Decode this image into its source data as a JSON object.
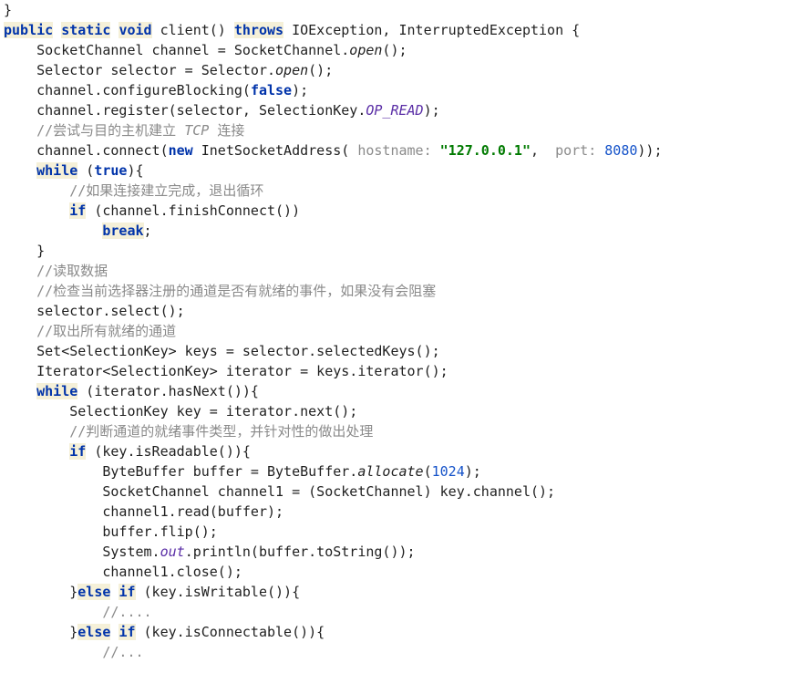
{
  "code": {
    "l01": "}",
    "l02": {
      "kw1": "public",
      "kw2": "static",
      "kw3": "void",
      "name": " client() ",
      "kw4": "throws",
      "exc": " IOException, InterruptedException {"
    },
    "l03a": "    SocketChannel channel = SocketChannel.",
    "l03m": "open",
    "l03b": "();",
    "l04a": "    Selector selector = Selector.",
    "l04m": "open",
    "l04b": "();",
    "l05a": "    channel.configureBlocking(",
    "l05k": "false",
    "l05b": ");",
    "l06a": "    channel.register(selector, SelectionKey.",
    "l06f": "OP_READ",
    "l06b": ");",
    "l07p": "    ",
    "l07c1": "//尝试与目的主机建立 ",
    "l07c2": "TCP",
    "l07c3": " 连接",
    "l08a": "    channel.connect(",
    "l08k": "new",
    "l08b": " InetSocketAddress( ",
    "l08h1": "hostname: ",
    "l08s": "\"127.0.0.1\"",
    "l08c": ",  ",
    "l08h2": "port: ",
    "l08n": "8080",
    "l08d": "));",
    "l09p": "    ",
    "l09k": "while",
    "l09a": " (",
    "l09t": "true",
    "l09b": "){",
    "l10p": "        ",
    "l10c": "//如果连接建立完成，退出循环",
    "l11p": "        ",
    "l11k": "if",
    "l11a": " (channel.finishConnect())",
    "l12p": "            ",
    "l12k": "break",
    "l12a": ";",
    "l13": "    }",
    "l14p": "    ",
    "l14c": "//读取数据",
    "l15p": "    ",
    "l15c": "//检查当前选择器注册的通道是否有就绪的事件，如果没有会阻塞",
    "l16": "    selector.select();",
    "l17p": "    ",
    "l17c": "//取出所有就绪的通道",
    "l18": "    Set<SelectionKey> keys = selector.selectedKeys();",
    "l19": "    Iterator<SelectionKey> iterator = keys.iterator();",
    "l20p": "    ",
    "l20k": "while",
    "l20a": " (iterator.hasNext()){",
    "l21": "        SelectionKey key = iterator.next();",
    "l22p": "        ",
    "l22c": "//判断通道的就绪事件类型，并针对性的做出处理",
    "l23p": "        ",
    "l23k": "if",
    "l23a": " (key.isReadable()){",
    "l24a": "            ByteBuffer buffer = ByteBuffer.",
    "l24m": "allocate",
    "l24b": "(",
    "l24n": "1024",
    "l24c": ");",
    "l25": "            SocketChannel channel1 = (SocketChannel) key.channel();",
    "l26": "            channel1.read(buffer);",
    "l27": "            buffer.flip();",
    "l28a": "            System.",
    "l28f": "out",
    "l28b": ".println(buffer.toString());",
    "l29": "            channel1.close();",
    "l30a": "        }",
    "l30k1": "else",
    "l30s": " ",
    "l30k2": "if",
    "l30b": " (key.isWritable()){",
    "l31p": "            ",
    "l31c": "//....",
    "l32a": "        }",
    "l32k1": "else",
    "l32s": " ",
    "l32k2": "if",
    "l32b": " (key.isConnectable()){",
    "l33p": "            ",
    "l33c": "//..."
  }
}
